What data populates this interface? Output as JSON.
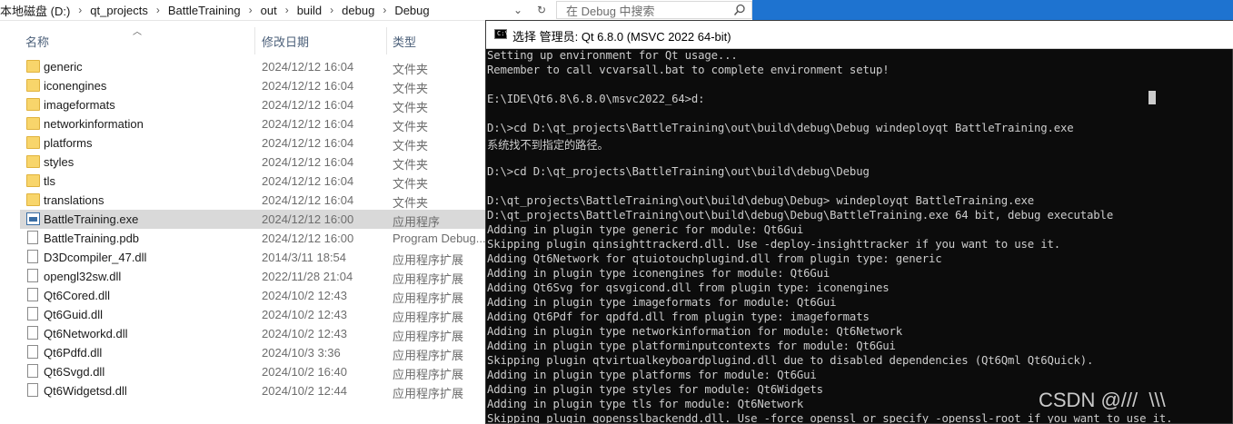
{
  "explorer": {
    "breadcrumb": [
      "本地磁盘 (D:)",
      "qt_projects",
      "BattleTraining",
      "out",
      "build",
      "debug",
      "Debug"
    ],
    "search_placeholder": "在 Debug 中搜索",
    "columns": {
      "name": "名称",
      "date": "修改日期",
      "type": "类型"
    },
    "files": [
      {
        "name": "generic",
        "date": "2024/12/12 16:04",
        "type": "文件夹",
        "icon": "folder-icon"
      },
      {
        "name": "iconengines",
        "date": "2024/12/12 16:04",
        "type": "文件夹",
        "icon": "folder-icon"
      },
      {
        "name": "imageformats",
        "date": "2024/12/12 16:04",
        "type": "文件夹",
        "icon": "folder-icon"
      },
      {
        "name": "networkinformation",
        "date": "2024/12/12 16:04",
        "type": "文件夹",
        "icon": "folder-icon"
      },
      {
        "name": "platforms",
        "date": "2024/12/12 16:04",
        "type": "文件夹",
        "icon": "folder-icon"
      },
      {
        "name": "styles",
        "date": "2024/12/12 16:04",
        "type": "文件夹",
        "icon": "folder-icon"
      },
      {
        "name": "tls",
        "date": "2024/12/12 16:04",
        "type": "文件夹",
        "icon": "folder-icon"
      },
      {
        "name": "translations",
        "date": "2024/12/12 16:04",
        "type": "文件夹",
        "icon": "folder-icon"
      },
      {
        "name": "BattleTraining.exe",
        "date": "2024/12/12 16:00",
        "type": "应用程序",
        "icon": "exe-icon",
        "selected": true
      },
      {
        "name": "BattleTraining.pdb",
        "date": "2024/12/12 16:00",
        "type": "Program Debug...",
        "icon": "file-icon"
      },
      {
        "name": "D3Dcompiler_47.dll",
        "date": "2014/3/11 18:54",
        "type": "应用程序扩展",
        "icon": "dll-icon"
      },
      {
        "name": "opengl32sw.dll",
        "date": "2022/11/28 21:04",
        "type": "应用程序扩展",
        "icon": "dll-icon"
      },
      {
        "name": "Qt6Cored.dll",
        "date": "2024/10/2 12:43",
        "type": "应用程序扩展",
        "icon": "dll-icon"
      },
      {
        "name": "Qt6Guid.dll",
        "date": "2024/10/2 12:43",
        "type": "应用程序扩展",
        "icon": "dll-icon"
      },
      {
        "name": "Qt6Networkd.dll",
        "date": "2024/10/2 12:43",
        "type": "应用程序扩展",
        "icon": "dll-icon"
      },
      {
        "name": "Qt6Pdfd.dll",
        "date": "2024/10/3 3:36",
        "type": "应用程序扩展",
        "icon": "dll-icon"
      },
      {
        "name": "Qt6Svgd.dll",
        "date": "2024/10/2 16:40",
        "type": "应用程序扩展",
        "icon": "dll-icon"
      },
      {
        "name": "Qt6Widgetsd.dll",
        "date": "2024/10/2 12:44",
        "type": "应用程序扩展",
        "icon": "dll-icon"
      }
    ]
  },
  "console": {
    "title": "选择 管理员: Qt 6.8.0 (MSVC 2022 64-bit)",
    "lines": [
      "Setting up environment for Qt usage...",
      "Remember to call vcvarsall.bat to complete environment setup!",
      "",
      "E:\\IDE\\Qt6.8\\6.8.0\\msvc2022_64>d:",
      "",
      "D:\\>cd D:\\qt_projects\\BattleTraining\\out\\build\\debug\\Debug windeployqt BattleTraining.exe",
      "系统找不到指定的路径。",
      "",
      "D:\\>cd D:\\qt_projects\\BattleTraining\\out\\build\\debug\\Debug",
      "",
      "D:\\qt_projects\\BattleTraining\\out\\build\\debug\\Debug> windeployqt BattleTraining.exe",
      "D:\\qt_projects\\BattleTraining\\out\\build\\debug\\Debug\\BattleTraining.exe 64 bit, debug executable",
      "Adding in plugin type generic for module: Qt6Gui",
      "Skipping plugin qinsighttrackerd.dll. Use -deploy-insighttracker if you want to use it.",
      "Adding Qt6Network for qtuiotouchplugind.dll from plugin type: generic",
      "Adding in plugin type iconengines for module: Qt6Gui",
      "Adding Qt6Svg for qsvgicond.dll from plugin type: iconengines",
      "Adding in plugin type imageformats for module: Qt6Gui",
      "Adding Qt6Pdf for qpdfd.dll from plugin type: imageformats",
      "Adding in plugin type networkinformation for module: Qt6Network",
      "Adding in plugin type platforminputcontexts for module: Qt6Gui",
      "Skipping plugin qtvirtualkeyboardplugind.dll due to disabled dependencies (Qt6Qml Qt6Quick).",
      "Adding in plugin type platforms for module: Qt6Gui",
      "Adding in plugin type styles for module: Qt6Widgets",
      "Adding in plugin type tls for module: Qt6Network",
      "Skipping plugin qopensslbackendd.dll. Use -force_openssl or specify -openssl-root if you want to use it."
    ]
  },
  "watermark": "CSDN @///  \\\\\\"
}
